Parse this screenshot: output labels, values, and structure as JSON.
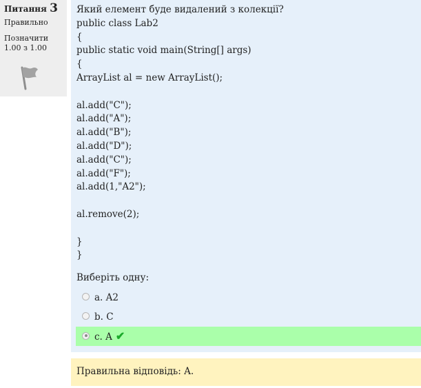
{
  "info": {
    "question_label": "Питання",
    "question_number": "3",
    "state": "Правильно",
    "flag_label": "Позначити",
    "grade": "1.00 з 1.00"
  },
  "question": {
    "text_lines": [
      "Який елемент буде видалений з колекції?",
      "public class Lab2",
      "{",
      "public static void main(String[] args)",
      "{",
      "ArrayList al = new ArrayList();",
      "",
      "al.add(\"C\");",
      "al.add(\"A\");",
      "al.add(\"B\");",
      "al.add(\"D\");",
      "al.add(\"C\");",
      "al.add(\"F\");",
      "al.add(1,\"A2\");",
      "",
      "al.remove(2);",
      "",
      "}",
      "}"
    ],
    "prompt": "Виберіть одну:",
    "answers": [
      {
        "label": "a. A2",
        "checked": false,
        "correct": false
      },
      {
        "label": "b. C",
        "checked": false,
        "correct": false
      },
      {
        "label": "c. A",
        "checked": true,
        "correct": true
      }
    ],
    "tick_icon": "check-icon",
    "correct_color": "#aaffaa",
    "tick_color": "#1aaa2a"
  },
  "feedback": {
    "right_answer": "Правильна відповідь: A."
  }
}
